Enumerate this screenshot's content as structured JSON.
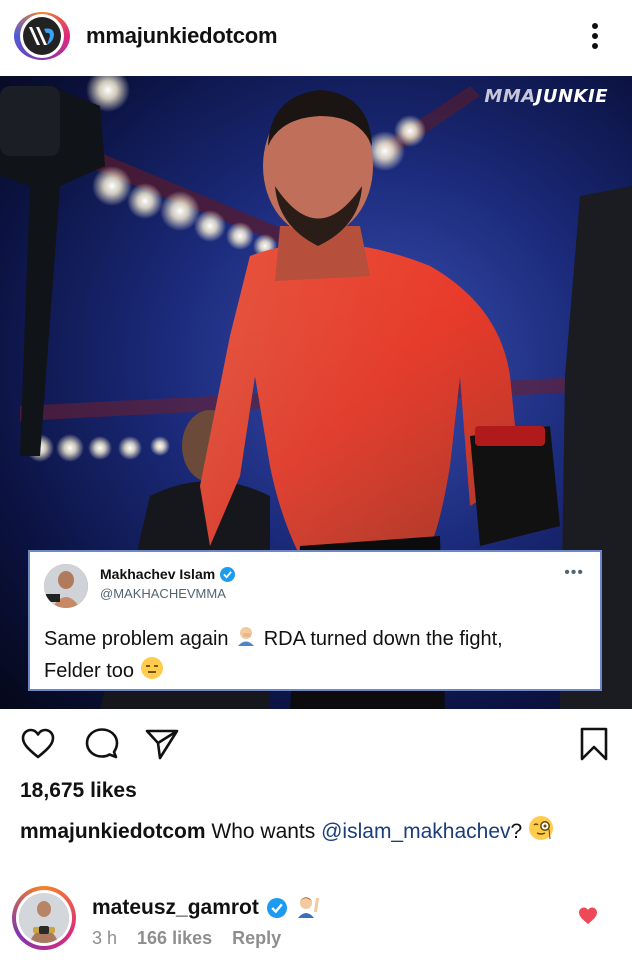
{
  "post": {
    "username": "mmajunkiedotcom",
    "watermark_mma": "MMA",
    "watermark_junkie": "JUNKIE",
    "likes": "18,675 likes",
    "caption_user": "mmajunkiedotcom",
    "caption_text": "Who wants",
    "caption_mention": "@islam_makhachev",
    "caption_end": "?"
  },
  "tweet": {
    "name": "Makhachev Islam",
    "handle": "@MAKHACHEVMMA",
    "more": "•••",
    "text_part1": "Same problem again",
    "text_part2": "RDA turned down the fight,",
    "text_part3": "Felder too"
  },
  "comment": {
    "username": "mateusz_gamrot",
    "time": "3 h",
    "likes": "166 likes",
    "reply": "Reply"
  },
  "icons": {
    "more": "more-vertical-icon",
    "like": "heart-outline-icon",
    "comment": "comment-icon",
    "share": "send-icon",
    "save": "bookmark-icon",
    "comment_like": "heart-filled-icon",
    "verified": "verified-badge-icon"
  },
  "colors": {
    "accent_red": "#ed4956",
    "verified_blue": "#1d9bf0",
    "tweet_border": "#6d88c2"
  }
}
